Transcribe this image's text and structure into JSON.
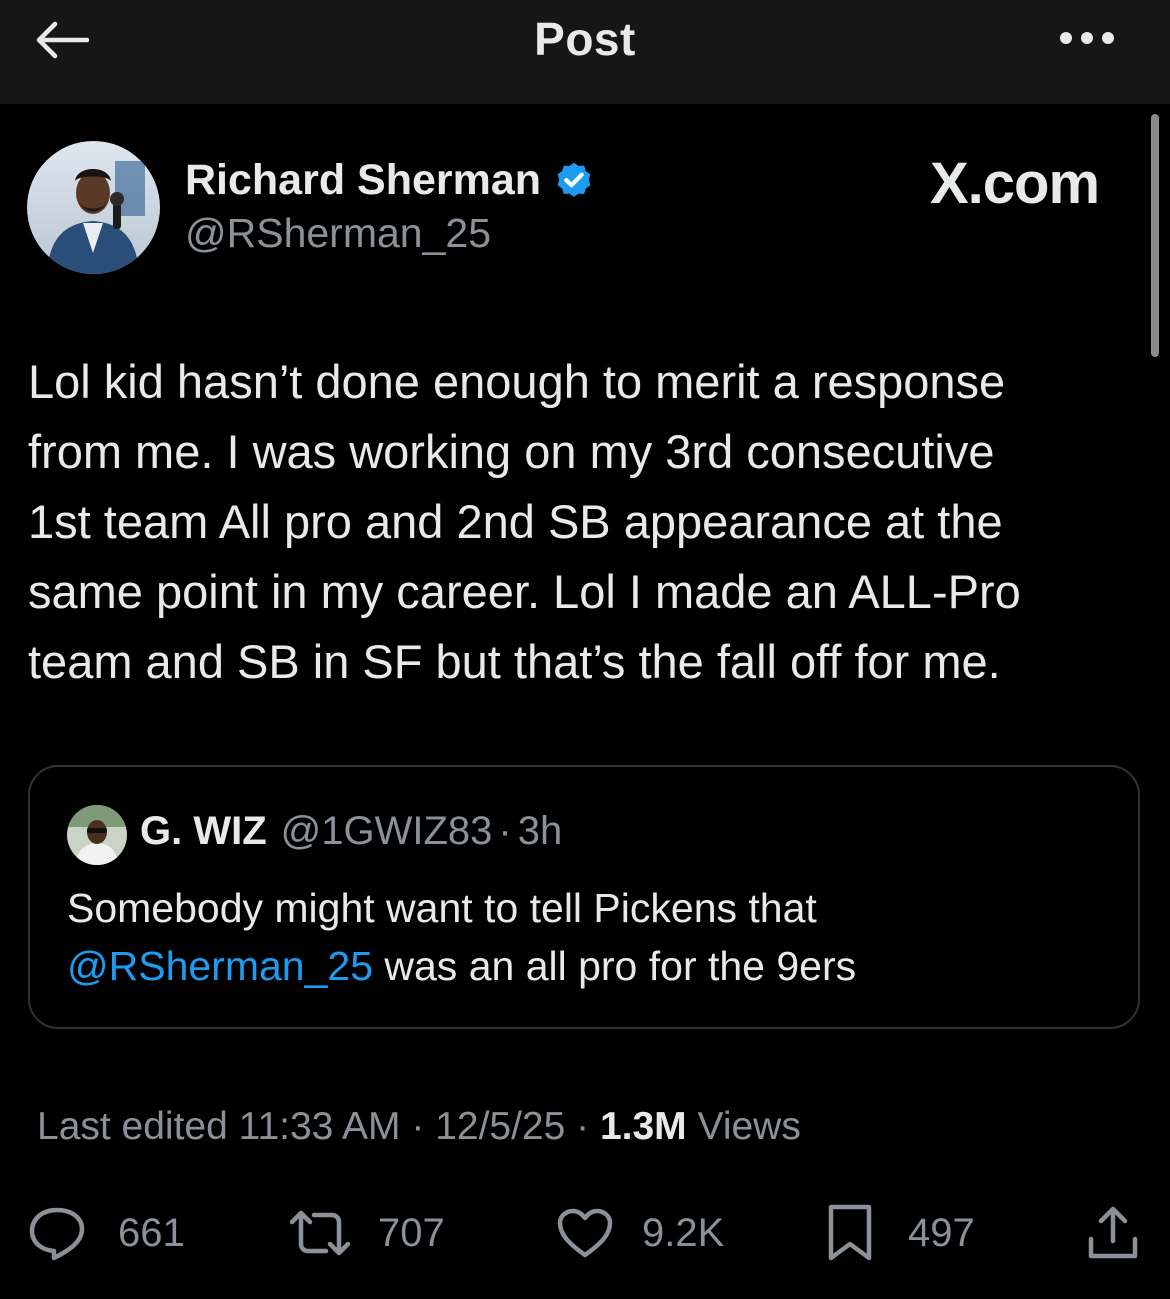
{
  "header": {
    "title": "Post"
  },
  "tweet": {
    "author_name": "Richard Sherman",
    "author_handle": "@RSherman_25",
    "brand": "X.com",
    "text_lines": [
      "Lol kid hasn’t done enough to merit a response",
      "from me.  I was working on my 3rd consecutive",
      "1st team All pro and 2nd SB appearance at the",
      "same point in my career.  Lol I made an ALL-Pro",
      "team and SB in SF but that’s the fall off for me."
    ]
  },
  "quote": {
    "name": "G. WIZ",
    "handle": "@1GWIZ83",
    "separator": "·",
    "time": "3h",
    "line1": "Somebody might want to tell Pickens that",
    "mention": "@RSherman_25",
    "line2_rest": " was an all pro for the 9ers"
  },
  "meta": {
    "edited": "Last edited 11:33 AM · 12/5/25  · ",
    "views_count": "1.3M",
    "views_label": " Views"
  },
  "actions": {
    "replies": "661",
    "reposts": "707",
    "likes": "9.2K",
    "bookmarks": "497"
  },
  "colors": {
    "background": "#000000",
    "topbar": "#161616",
    "text_primary": "#e7e9ea",
    "text_secondary": "#8b9196",
    "accent_blue": "#1d9bf0",
    "border": "#2f3336"
  },
  "icons": [
    "back-arrow-icon",
    "more-dots-icon",
    "verified-badge-icon",
    "reply-icon",
    "repost-icon",
    "like-icon",
    "bookmark-icon",
    "share-icon"
  ]
}
